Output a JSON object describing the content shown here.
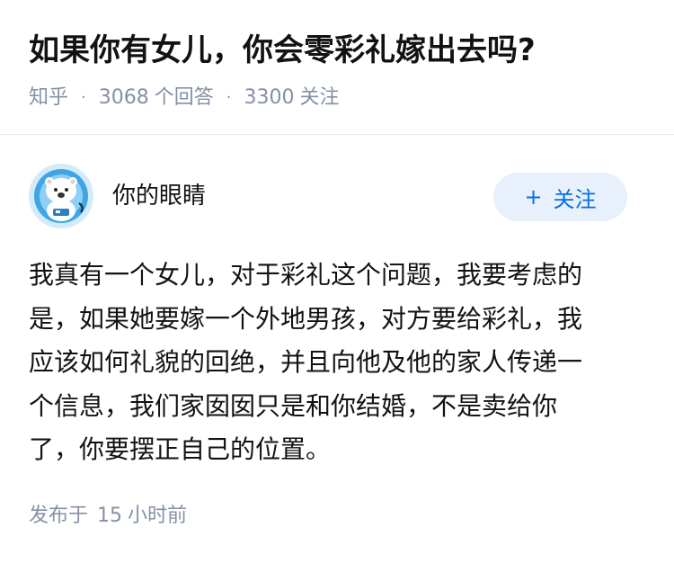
{
  "question": {
    "title": "如果你有女儿，你会零彩礼嫁出去吗?",
    "source": "知乎",
    "separator": "·",
    "answer_count": "3068",
    "answer_label": "个回答",
    "follower_count": "3300",
    "follower_label": "关注"
  },
  "author": {
    "name": "你的眼睛",
    "avatar_icon": "polar-bear-astronaut-avatar",
    "follow_label": "关注",
    "follow_icon": "plus-icon"
  },
  "answer": {
    "lines": [
      "我真有一个女儿，对于彩礼这个问题，我要考虑的",
      "是，如果她要嫁一个外地男孩，对方要给彩礼，我",
      "应该如何礼貌的回绝，并且向他及他的家人传递一",
      "个信息，我们家囡囡只是和你结婚，不是卖给你",
      "了，你要摆正自己的位置。"
    ],
    "time_prefix": "发布于",
    "time_value": "15",
    "time_suffix": "小时前"
  },
  "colors": {
    "accent": "#056de8",
    "follow_bg": "#e8f1fb",
    "meta_text": "#8590a6",
    "body_text": "#121212",
    "divider": "#ececec"
  }
}
